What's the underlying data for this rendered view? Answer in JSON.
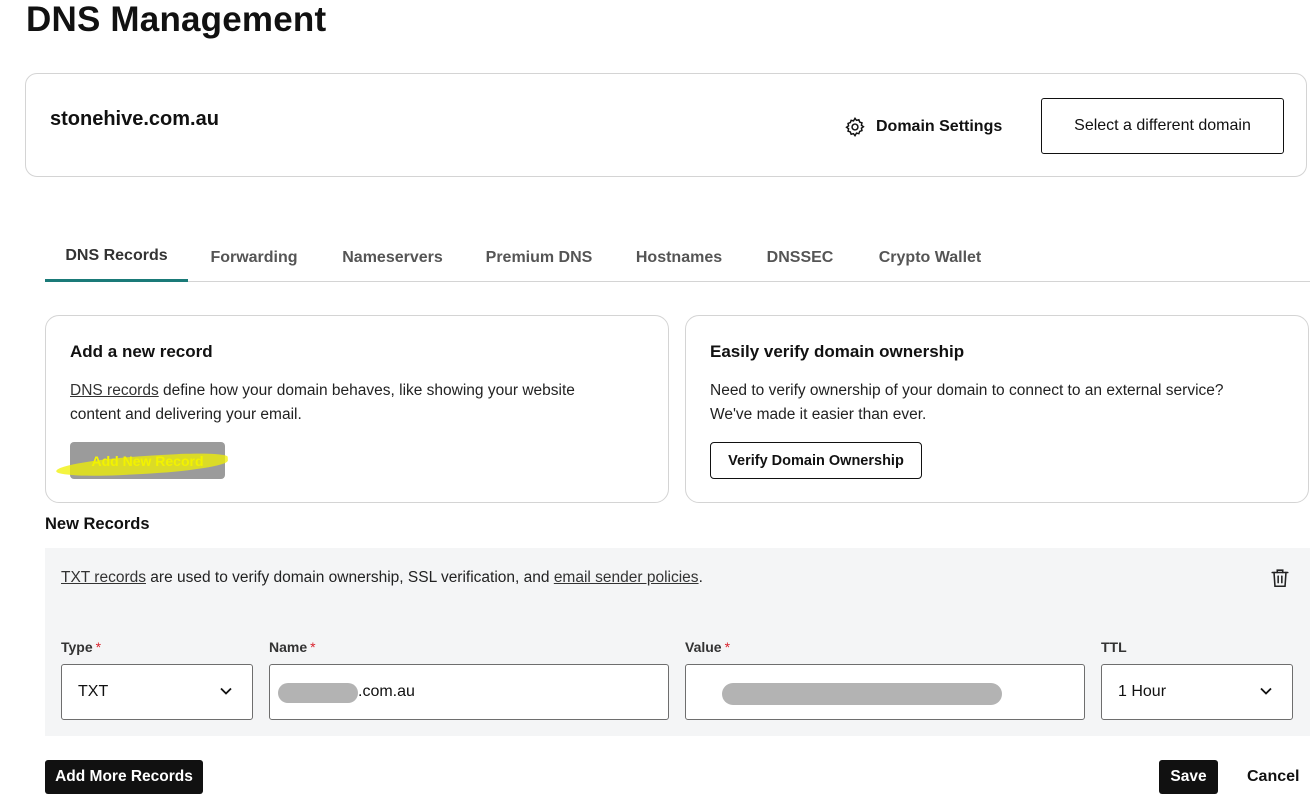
{
  "page": {
    "title": "DNS Management"
  },
  "domain": {
    "name": "stonehive.com.au",
    "settings_label": "Domain Settings",
    "settings_icon": "gear-icon",
    "select_different_label": "Select a different domain"
  },
  "tabs": [
    {
      "label": "DNS Records",
      "active": true
    },
    {
      "label": "Forwarding",
      "active": false
    },
    {
      "label": "Nameservers",
      "active": false
    },
    {
      "label": "Premium DNS",
      "active": false
    },
    {
      "label": "Hostnames",
      "active": false
    },
    {
      "label": "DNSSEC",
      "active": false
    },
    {
      "label": "Crypto Wallet",
      "active": false
    }
  ],
  "add_record_card": {
    "title": "Add a new record",
    "link_text": "DNS records",
    "text_after_link": " define how your domain behaves, like showing your website",
    "text_line2": "content and delivering your email.",
    "button_label": "Add New Record",
    "highlight_color": "#f0f000"
  },
  "verify_card": {
    "title": "Easily verify domain ownership",
    "text_line1": "Need to verify ownership of your domain to connect to an external service?",
    "text_line2": "We've made it easier than ever.",
    "button_label": "Verify Domain Ownership"
  },
  "new_records": {
    "heading": "New Records",
    "info_link1": "TXT records",
    "info_middle": " are used to verify domain ownership, SSL verification, and ",
    "info_link2": "email sender policies",
    "info_end": ".",
    "delete_icon": "trash-icon",
    "fields": {
      "type": {
        "label": "Type",
        "required_mark": "*",
        "value": "TXT"
      },
      "name": {
        "label": "Name",
        "required_mark": "*",
        "value_suffix": ".com.au",
        "redacted": true
      },
      "value": {
        "label": "Value",
        "required_mark": "*",
        "value": "",
        "redacted": true
      },
      "ttl": {
        "label": "TTL",
        "value": "1 Hour"
      }
    }
  },
  "footer": {
    "add_more_label": "Add More Records",
    "save_label": "Save",
    "cancel_label": "Cancel"
  },
  "colors": {
    "accent_tab_underline": "#1a7a78",
    "required": "#d9232d",
    "primary_button": "#111111",
    "panel_background": "#f4f5f6"
  }
}
